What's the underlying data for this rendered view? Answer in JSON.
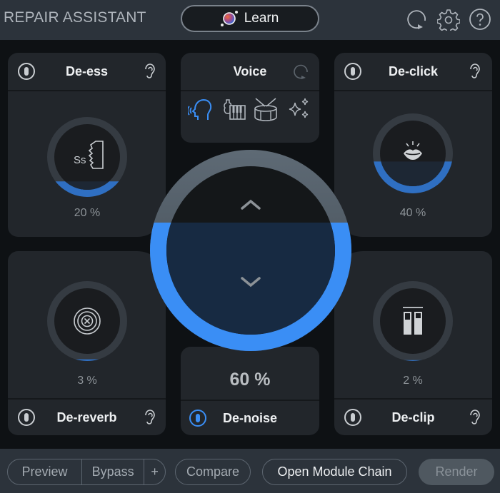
{
  "header": {
    "title": "REPAIR ASSISTANT",
    "learn_label": "Learn",
    "icons": [
      "reset-icon",
      "settings-gear-icon",
      "help-icon"
    ]
  },
  "voice_panel": {
    "title": "Voice",
    "reset_icon": "reset-icon",
    "types": [
      {
        "name": "voice",
        "icon": "speaking-head-icon",
        "selected": true
      },
      {
        "name": "music",
        "icon": "instruments-icon",
        "selected": false
      },
      {
        "name": "percussion",
        "icon": "drum-icon",
        "selected": false
      },
      {
        "name": "other",
        "icon": "sparkles-icon",
        "selected": false
      }
    ]
  },
  "modules": {
    "de_ess": {
      "title": "De-ess",
      "value": 20,
      "value_label": "20 %",
      "enabled": false,
      "icon": "sibilance-face-icon"
    },
    "de_click": {
      "title": "De-click",
      "value": 40,
      "value_label": "40 %",
      "enabled": false,
      "icon": "lips-click-icon"
    },
    "de_reverb": {
      "title": "De-reverb",
      "value": 3,
      "value_label": "3 %",
      "enabled": false,
      "icon": "reverb-target-icon"
    },
    "de_clip": {
      "title": "De-clip",
      "value": 2,
      "value_label": "2 %",
      "enabled": false,
      "icon": "clip-meter-icon"
    },
    "de_noise": {
      "title": "De-noise",
      "value": 60,
      "value_label": "60 %",
      "enabled": true
    }
  },
  "footer": {
    "preview_label": "Preview",
    "bypass_label": "Bypass",
    "plus_label": "+",
    "compare_label": "Compare",
    "open_chain_label": "Open Module Chain",
    "render_label": "Render"
  },
  "colors": {
    "accent": "#3a8ef5",
    "accent_dim": "#2f6fc2",
    "fill_dark": "#172a42",
    "card": "#22262b",
    "bar": "#2c333b"
  }
}
